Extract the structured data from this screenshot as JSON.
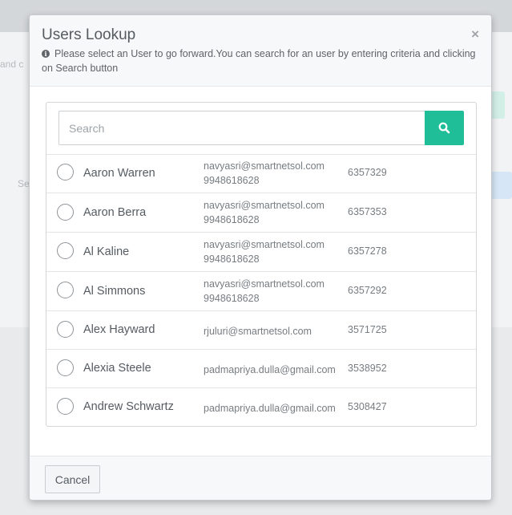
{
  "background": {
    "fragment_left": "and c",
    "fragment_se": "Se",
    "fragment_button": "d"
  },
  "modal": {
    "title": "Users Lookup",
    "close_label": "×",
    "hint": "Please select an User to go forward.You can search for an user by entering criteria and clicking on Search button",
    "search": {
      "placeholder": "Search",
      "value": ""
    },
    "users": [
      {
        "name": "Aaron Warren",
        "email": "navyasri@smartnetsol.com",
        "phone_secondary": "9948618628",
        "id": "6357329"
      },
      {
        "name": "Aaron Berra",
        "email": "navyasri@smartnetsol.com",
        "phone_secondary": "9948618628",
        "id": "6357353"
      },
      {
        "name": "Al Kaline",
        "email": "navyasri@smartnetsol.com",
        "phone_secondary": "9948618628",
        "id": "6357278"
      },
      {
        "name": "Al Simmons",
        "email": "navyasri@smartnetsol.com",
        "phone_secondary": "9948618628",
        "id": "6357292"
      },
      {
        "name": "Alex Hayward",
        "email": "rjuluri@smartnetsol.com",
        "id": "3571725"
      },
      {
        "name": "Alexia Steele",
        "email": "padmapriya.dulla@gmail.com",
        "id": "3538952"
      },
      {
        "name": "Andrew Schwartz",
        "email": "padmapriya.dulla@gmail.com",
        "id": "5308427"
      }
    ],
    "footer": {
      "cancel_label": "Cancel"
    }
  },
  "colors": {
    "accent": "#1fbe99",
    "text": "#555b61",
    "muted": "#777c81"
  }
}
